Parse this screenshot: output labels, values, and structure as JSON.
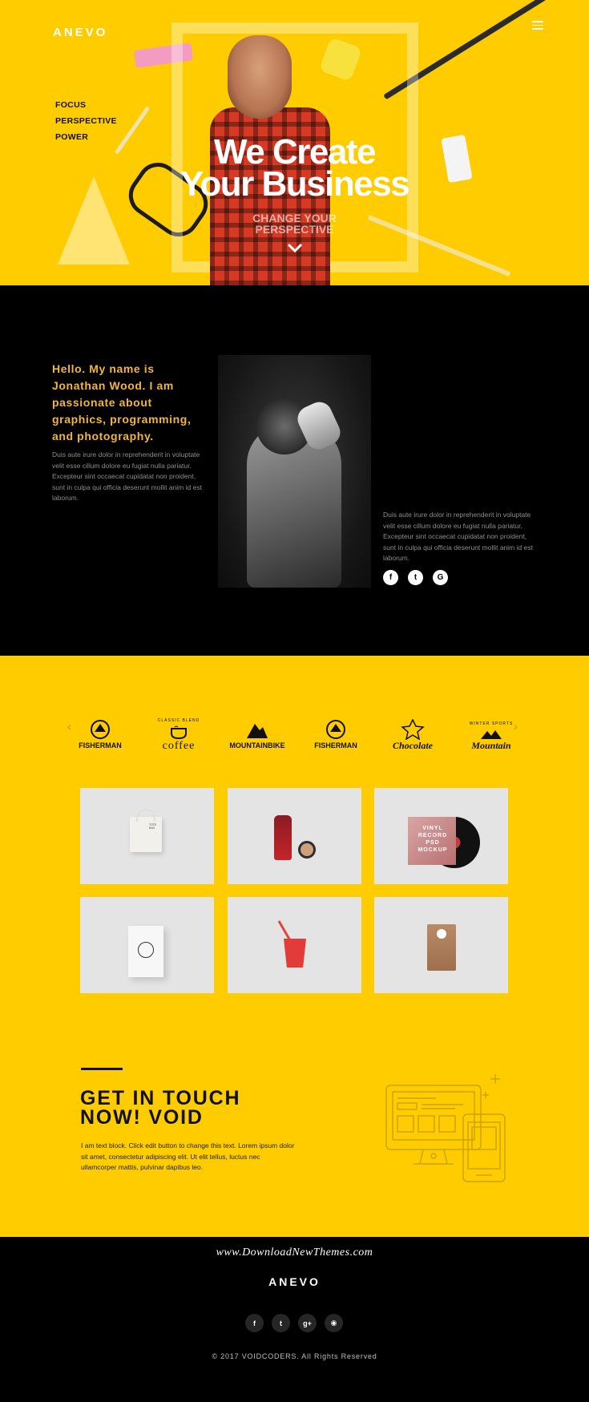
{
  "hero": {
    "logo": "ANEVO",
    "nav": [
      "FOCUS",
      "PERSPECTIVE",
      "POWER"
    ],
    "title_line1": "We Create",
    "title_line2": "Your Business",
    "subtitle_line1": "CHANGE YOUR",
    "subtitle_line2": "PERSPECTIVE",
    "icons": [
      "menu-icon",
      "chevron-down-icon"
    ],
    "accent_color": "#ffcc00"
  },
  "about": {
    "heading": "Hello. My name is Jonathan Wood. I am passionate about graphics, programming, and photography.",
    "text1": "Duis aute irure dolor in reprehenderit in voluptate velit esse cillum dolore eu fugiat nulla pariatur. Excepteur sint occaecat cupidatat non proident, sunt in culpa qui officia deserunt mollit anim id est laborum.",
    "text2": "Duis aute irure dolor in reprehenderit in voluptate velit esse cillum dolore eu fugiat nulla pariatur. Excepteur sint occaecat cupidatat non proident, sunt in culpa qui officia deserunt mollit anim id est laborum.",
    "socials": [
      {
        "icon": "facebook-icon",
        "glyph": "f"
      },
      {
        "icon": "twitter-icon",
        "glyph": "t"
      },
      {
        "icon": "google-plus-icon",
        "glyph": "G"
      }
    ],
    "heading_color": "#f2b63a"
  },
  "brands": {
    "prev_glyph": "‹",
    "next_glyph": "›",
    "items": [
      {
        "name": "FISHERMAN"
      },
      {
        "name": "coffee",
        "top": "CLASSIC  BLEND"
      },
      {
        "name": "MOUNTAINBIKE"
      },
      {
        "name": "FISHERMAN"
      },
      {
        "name": "Chocolate"
      },
      {
        "name": "Mountain",
        "top": "WINTER SPORTS"
      }
    ]
  },
  "portfolio": {
    "tiles": [
      {
        "subject": "tote-bag",
        "caption": "TOTE BAG"
      },
      {
        "subject": "bottle-and-jar",
        "caption": ""
      },
      {
        "subject": "vinyl-record",
        "caption_line1": "VINYL",
        "caption_line2": "RECORD",
        "caption_line3": "PSD",
        "caption_line4": "MOCKUP"
      },
      {
        "subject": "shopping-bag",
        "caption": ""
      },
      {
        "subject": "paper-cup",
        "caption": ""
      },
      {
        "subject": "coffee-pouch",
        "caption": ""
      }
    ]
  },
  "contact": {
    "title_line1": "GET IN TOUCH",
    "title_line2": "NOW! VOID",
    "text": "I am text block. Click edit button to change this text. Lorem ipsum dolor sit amet, consectetur adipiscing elit. Ut elit tellus, luctus nec ullamcorper mattis, pulvinar dapibus leo."
  },
  "footer": {
    "watermark": "www.DownloadNewThemes.com",
    "logo": "ANEVO",
    "socials": [
      {
        "icon": "facebook-icon",
        "glyph": "f"
      },
      {
        "icon": "twitter-icon",
        "glyph": "t"
      },
      {
        "icon": "google-plus-icon",
        "glyph": "g+"
      },
      {
        "icon": "github-icon",
        "glyph": "◉"
      }
    ],
    "copyright": "© 2017 VOIDCODERS. All Rights Reserved"
  }
}
